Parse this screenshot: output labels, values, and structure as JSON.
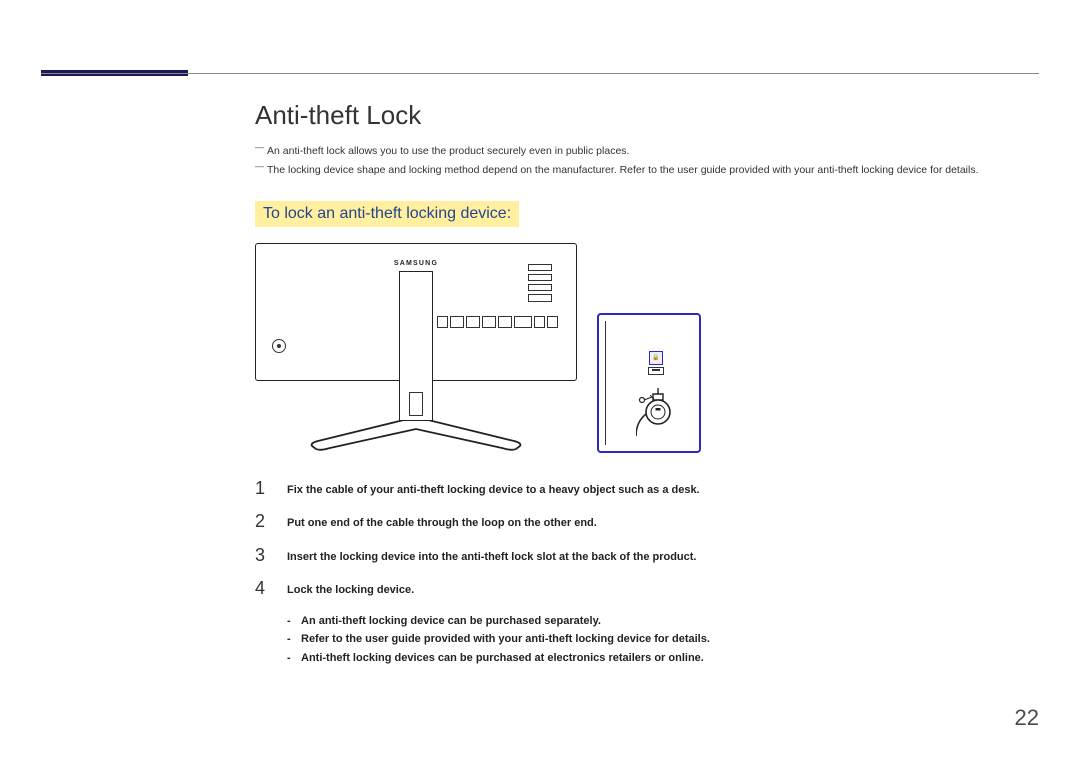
{
  "page_number": "22",
  "title": "Anti-theft Lock",
  "notes": [
    "An anti-theft lock allows you to use the product securely even in public places.",
    "The locking device shape and locking method depend on the manufacturer. Refer to the user guide provided with your anti-theft locking device for details."
  ],
  "sub_heading": "To lock an anti-theft locking device:",
  "illustration": {
    "brand_label": "SAMSUNG",
    "lock_slot_icon_label": "🔒"
  },
  "steps": [
    {
      "num": "1",
      "text": "Fix the cable of your anti-theft locking device to a heavy object such as a desk."
    },
    {
      "num": "2",
      "text": "Put one end of the cable through the loop on the other end."
    },
    {
      "num": "3",
      "text": "Insert the locking device into the anti-theft lock slot at the back of the product."
    },
    {
      "num": "4",
      "text": "Lock the locking device."
    }
  ],
  "sub_notes": [
    "An anti-theft locking device can be purchased separately.",
    "Refer to the user guide provided with your anti-theft locking device for details.",
    "Anti-theft locking devices can be purchased at electronics retailers or online."
  ]
}
